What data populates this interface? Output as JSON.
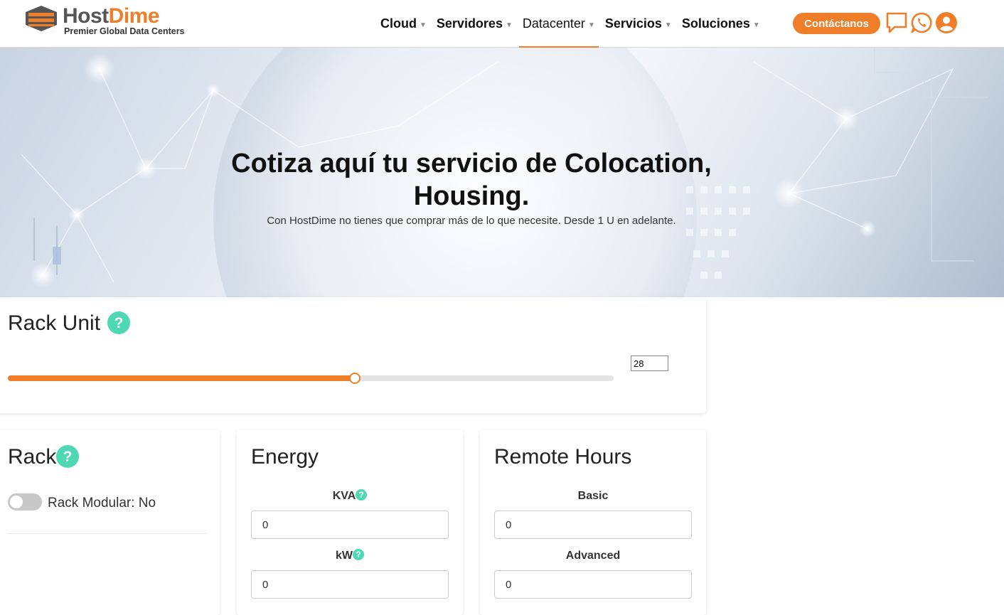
{
  "brand": {
    "name_part1": "Host",
    "name_part2": "Dime",
    "tagline": "Premier Global Data Centers"
  },
  "nav": {
    "items": [
      {
        "label": "Cloud"
      },
      {
        "label": "Servidores"
      },
      {
        "label": "Datacenter",
        "active": true
      },
      {
        "label": "Servicios"
      },
      {
        "label": "Soluciones"
      }
    ],
    "contact_label": "Contáctanos"
  },
  "hero": {
    "title_line1": "Cotiza aquí tu servicio de Colocation,",
    "title_line2": "Housing.",
    "subtitle": "Con HostDime no tienes que comprar más de lo que necesite. Desde 1 U en adelante."
  },
  "rack_unit": {
    "title": "Rack Unit",
    "value": "28",
    "slider_fraction": 0.573
  },
  "rack": {
    "title": "Rack",
    "toggle_label": "Rack Modular: No",
    "toggle_on": false
  },
  "energy": {
    "title": "Energy",
    "fields": [
      {
        "label": "KVA",
        "value": "0"
      },
      {
        "label": "kW",
        "value": "0"
      }
    ]
  },
  "remote_hours": {
    "title": "Remote Hours",
    "fields": [
      {
        "label": "Basic",
        "value": "0"
      },
      {
        "label": "Advanced",
        "value": "0"
      }
    ]
  },
  "colors": {
    "accent": "#f07d28",
    "help": "#4fd8b4"
  }
}
